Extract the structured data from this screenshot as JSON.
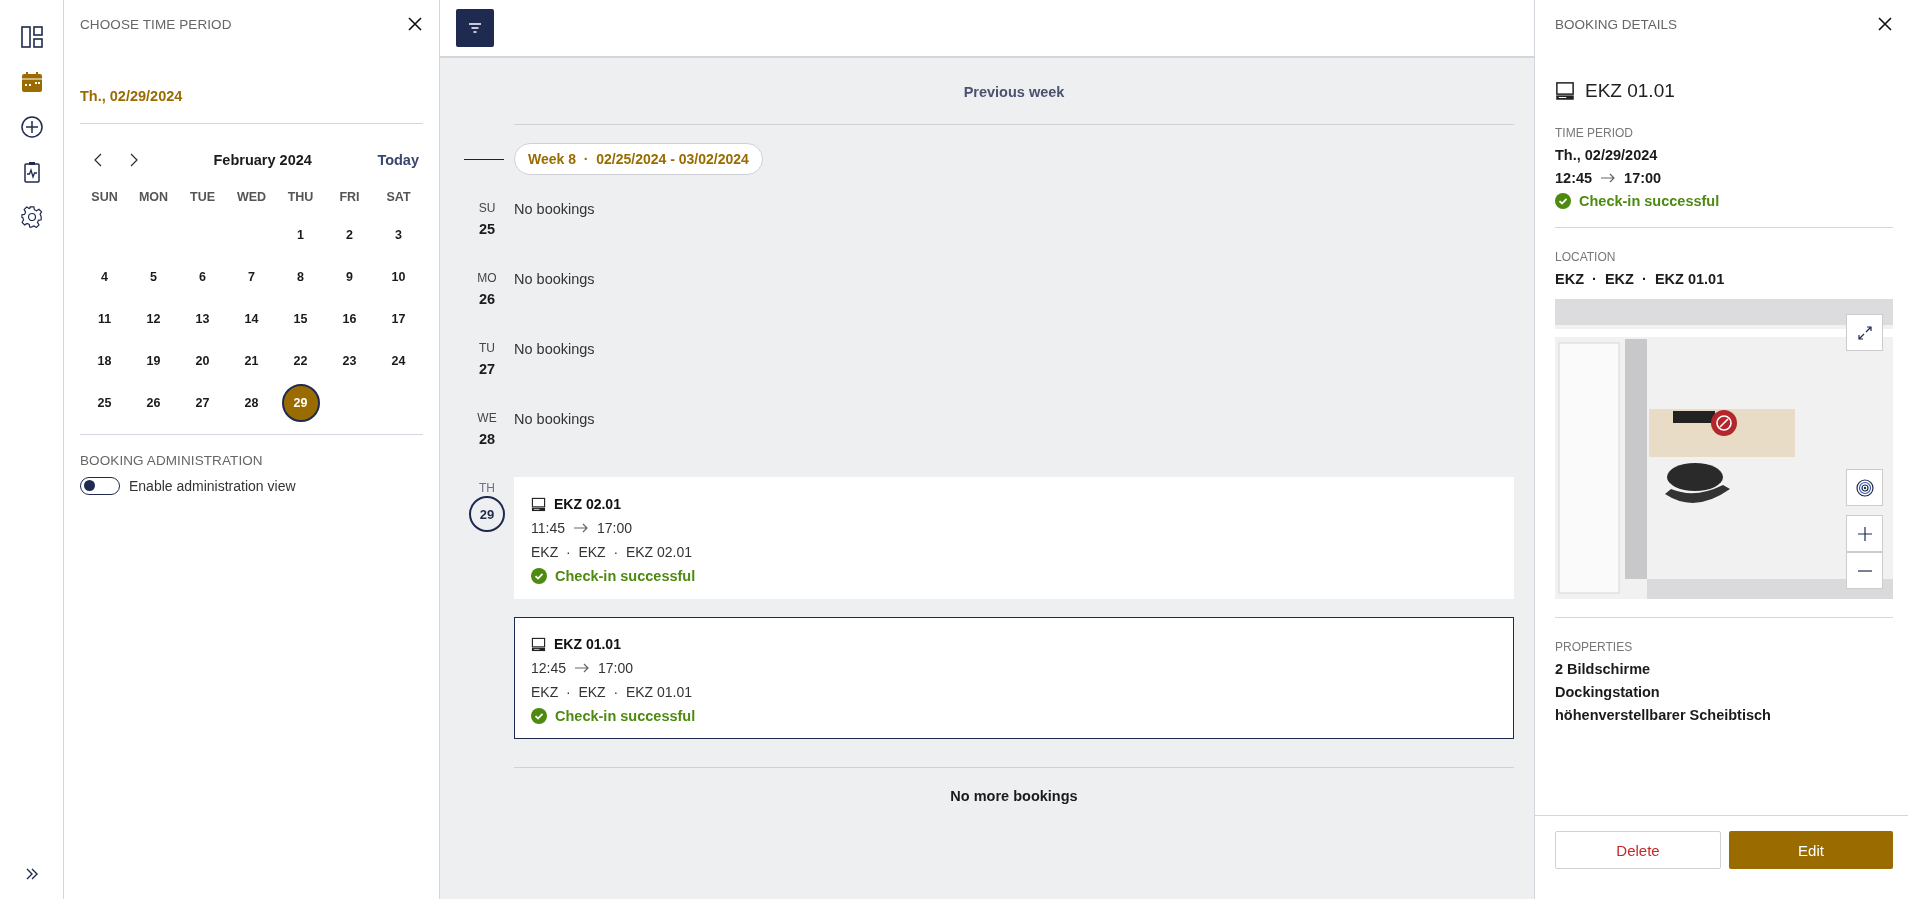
{
  "nav_rail": {
    "items": [
      {
        "kind": "dashboard",
        "selected": false
      },
      {
        "kind": "calendar",
        "selected": true
      },
      {
        "kind": "add",
        "selected": false
      },
      {
        "kind": "report",
        "selected": false
      },
      {
        "kind": "settings",
        "selected": false
      }
    ]
  },
  "period_panel": {
    "title": "CHOOSE TIME PERIOD",
    "selected_date": "Th., 02/29/2024",
    "month": "February 2024",
    "today_link": "Today",
    "weekdays": [
      "SUN",
      "MON",
      "TUE",
      "WED",
      "THU",
      "FRI",
      "SAT"
    ],
    "weeks": [
      [
        {
          "day": "1",
          "selected": false
        },
        {
          "day": "2",
          "selected": false
        },
        {
          "day": "3",
          "selected": false
        }
      ],
      [
        {
          "day": "4",
          "selected": false
        },
        {
          "day": "5",
          "selected": false
        },
        {
          "day": "6",
          "selected": false
        },
        {
          "day": "7",
          "selected": false
        },
        {
          "day": "8",
          "selected": false
        },
        {
          "day": "9",
          "selected": false
        },
        {
          "day": "10",
          "selected": false
        }
      ],
      [
        {
          "day": "11",
          "selected": false
        },
        {
          "day": "12",
          "selected": false
        },
        {
          "day": "13",
          "selected": false
        },
        {
          "day": "14",
          "selected": false
        },
        {
          "day": "15",
          "selected": false
        },
        {
          "day": "16",
          "selected": false
        },
        {
          "day": "17",
          "selected": false
        }
      ],
      [
        {
          "day": "18",
          "selected": false
        },
        {
          "day": "19",
          "selected": false
        },
        {
          "day": "20",
          "selected": false
        },
        {
          "day": "21",
          "selected": false
        },
        {
          "day": "22",
          "selected": false
        },
        {
          "day": "23",
          "selected": false
        },
        {
          "day": "24",
          "selected": false
        }
      ],
      [
        {
          "day": "25",
          "selected": false
        },
        {
          "day": "26",
          "selected": false
        },
        {
          "day": "27",
          "selected": false
        },
        {
          "day": "28",
          "selected": false
        },
        {
          "day": "29",
          "selected": true
        }
      ]
    ],
    "admin_heading": "BOOKING ADMINISTRATION",
    "admin_toggle": {
      "label": "Enable administration view",
      "on": false
    }
  },
  "week_view": {
    "previous_link": "Previous week",
    "week_pill": "Week 8  ·  02/25/2024 - 03/02/2024",
    "days": [
      {
        "abbr": "SU",
        "number": "25",
        "selected": false,
        "empty_text": "No bookings"
      },
      {
        "abbr": "MO",
        "number": "26",
        "selected": false,
        "empty_text": "No bookings"
      },
      {
        "abbr": "TU",
        "number": "27",
        "selected": false,
        "empty_text": "No bookings"
      },
      {
        "abbr": "WE",
        "number": "28",
        "selected": false,
        "empty_text": "No bookings"
      },
      {
        "abbr": "TH",
        "number": "29",
        "selected": true,
        "bookings": [
          {
            "name": "EKZ 02.01",
            "start": "11:45",
            "end": "17:00",
            "location": "EKZ  ·  EKZ  ·  EKZ 02.01",
            "status": "Check-in successful",
            "selected": false
          },
          {
            "name": "EKZ 01.01",
            "start": "12:45",
            "end": "17:00",
            "location": "EKZ  ·  EKZ  ·  EKZ 01.01",
            "status": "Check-in successful",
            "selected": true
          }
        ]
      }
    ],
    "end_text": "No more bookings"
  },
  "details": {
    "title": "BOOKING DETAILS",
    "resource": "EKZ 01.01",
    "time_heading": "TIME PERIOD",
    "date": "Th., 02/29/2024",
    "start": "12:45",
    "end": "17:00",
    "status": "Check-in successful",
    "location_heading": "LOCATION",
    "location": "EKZ  ·  EKZ  ·  EKZ 01.01",
    "properties_heading": "PROPERTIES",
    "properties": [
      "2 Bildschirme",
      "Dockingstation",
      "höhenverstellbarer Scheibtisch"
    ],
    "buttons": [
      {
        "label": "Delete",
        "kind": "secondary"
      },
      {
        "label": "Edit",
        "kind": "primary"
      }
    ]
  }
}
